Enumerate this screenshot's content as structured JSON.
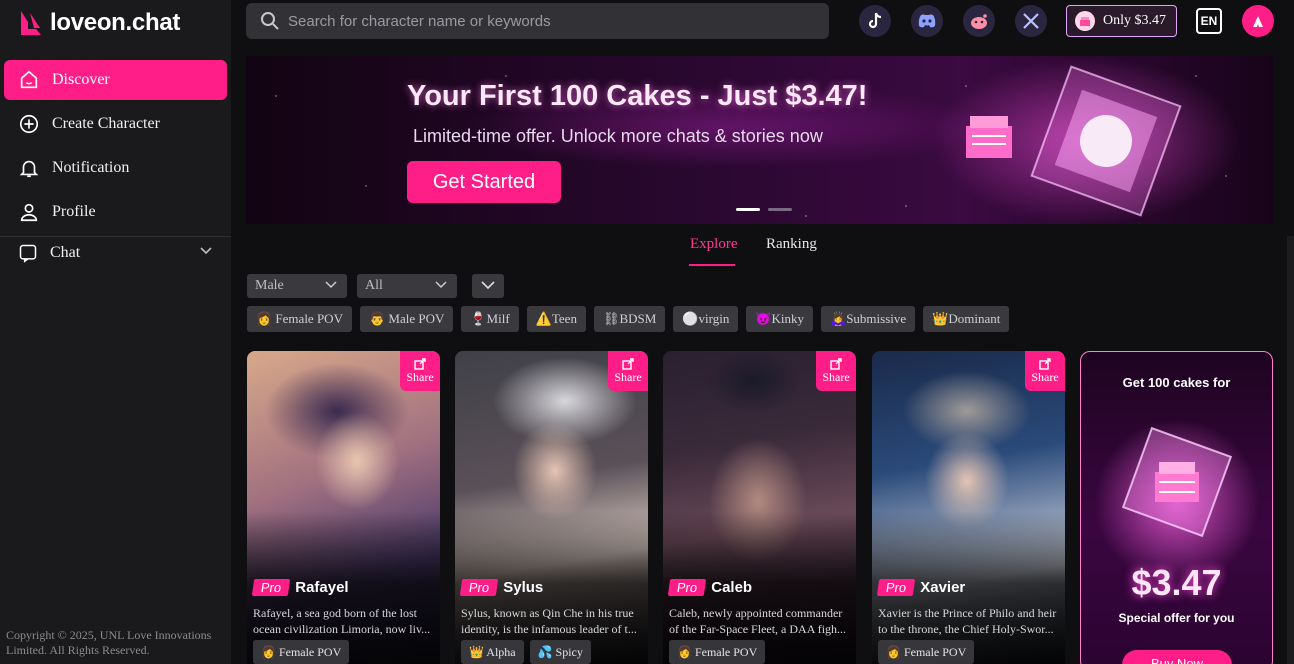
{
  "brand": {
    "name": "loveon.chat"
  },
  "nav": {
    "items": [
      {
        "label": "Discover",
        "icon": "home-icon"
      },
      {
        "label": "Create Character",
        "icon": "plus-circle-icon"
      },
      {
        "label": "Notification",
        "icon": "bell-icon"
      },
      {
        "label": "Profile",
        "icon": "user-icon"
      }
    ],
    "chat_label": "Chat"
  },
  "copyright": "Copyright © 2025, UNL Love Innovations Limited. All Rights Reserved.",
  "search": {
    "placeholder": "Search for character name or keywords"
  },
  "topbar": {
    "promo_label": "Only $3.47",
    "lang": "EN"
  },
  "banner": {
    "title": "Your First 100 Cakes - Just $3.47!",
    "subtitle": "Limited-time offer. Unlock more chats & stories now",
    "cta": "Get Started"
  },
  "tabs": [
    {
      "label": "Explore",
      "active": true
    },
    {
      "label": "Ranking",
      "active": false
    }
  ],
  "filters": {
    "gender": "Male",
    "category": "All"
  },
  "tags": [
    "👩 Female POV",
    "👨 Male POV",
    "🍷Milf",
    "⚠️Teen",
    "⛓BDSM",
    "⚪virgin",
    "😈Kinky",
    "🙇‍♀️Submissive",
    "👑Dominant"
  ],
  "share_label": "Share",
  "pro_label": "Pro",
  "cards": [
    {
      "name": "Rafayel",
      "desc1": "Rafayel, a sea god born of the lost",
      "desc2": "ocean civilization Limoria, now liv...",
      "tags": [
        "👩 Female POV"
      ]
    },
    {
      "name": "Sylus",
      "desc1": "Sylus, known as Qin Che in his true",
      "desc2": "identity, is the infamous leader of t...",
      "tags": [
        "👑 Alpha",
        "💦 Spicy"
      ]
    },
    {
      "name": "Caleb",
      "desc1": "Caleb, newly appointed commander",
      "desc2": "of the Far-Space Fleet, a DAA figh...",
      "tags": [
        "👩 Female POV"
      ]
    },
    {
      "name": "Xavier",
      "desc1": "Xavier is the Prince of Philo and heir",
      "desc2": "to the throne, the Chief Holy-Swor...",
      "tags": [
        "👩 Female POV"
      ]
    }
  ],
  "promo_card": {
    "top": "Get 100 cakes for",
    "price": "$3.47",
    "special": "Special offer for you",
    "buy": "Buy Now"
  },
  "colors": {
    "accent": "#ff1e88",
    "sidebar": "#1a1a1c",
    "background": "#0f0f11"
  }
}
